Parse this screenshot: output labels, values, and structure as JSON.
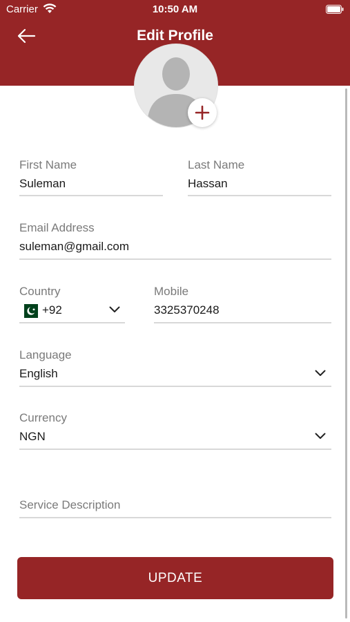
{
  "status_bar": {
    "carrier": "Carrier",
    "time": "10:50 AM"
  },
  "header": {
    "title": "Edit Profile",
    "color": "#962526"
  },
  "form": {
    "first_name": {
      "label": "First Name",
      "value": "Suleman"
    },
    "last_name": {
      "label": "Last Name",
      "value": "Hassan"
    },
    "email": {
      "label": "Email Address",
      "value": "suleman@gmail.com"
    },
    "country": {
      "label": "Country",
      "code": "+92",
      "flag_icon": "pakistan-flag-icon"
    },
    "mobile": {
      "label": "Mobile",
      "value": "3325370248"
    },
    "language": {
      "label": "Language",
      "value": "English"
    },
    "currency": {
      "label": "Currency",
      "value": "NGN"
    },
    "service_description": {
      "placeholder": "Service Description"
    }
  },
  "actions": {
    "update_label": "UPDATE"
  },
  "icons": [
    "wifi-icon",
    "battery-icon",
    "back-arrow-icon",
    "avatar-placeholder-icon",
    "plus-icon",
    "chevron-down-icon",
    "pakistan-flag-icon"
  ]
}
